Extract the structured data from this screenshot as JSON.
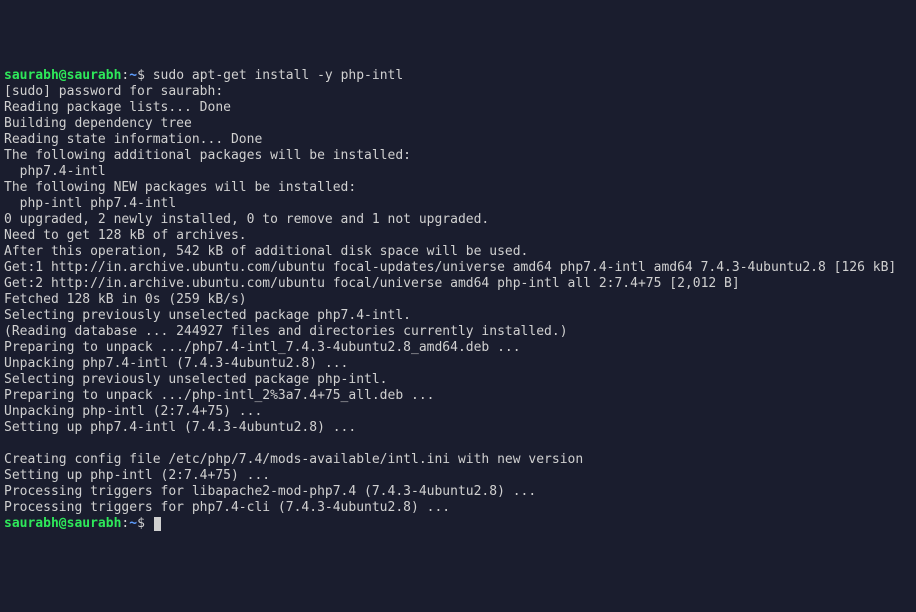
{
  "prompt1": {
    "user": "saurabh",
    "at": "@",
    "host": "saurabh",
    "colon": ":",
    "path": "~",
    "dollar": "$ ",
    "command": "sudo apt-get install -y php-intl"
  },
  "lines": [
    "[sudo] password for saurabh: ",
    "Reading package lists... Done",
    "Building dependency tree       ",
    "Reading state information... Done",
    "The following additional packages will be installed:",
    "  php7.4-intl",
    "The following NEW packages will be installed:",
    "  php-intl php7.4-intl",
    "0 upgraded, 2 newly installed, 0 to remove and 1 not upgraded.",
    "Need to get 128 kB of archives.",
    "After this operation, 542 kB of additional disk space will be used.",
    "Get:1 http://in.archive.ubuntu.com/ubuntu focal-updates/universe amd64 php7.4-intl amd64 7.4.3-4ubuntu2.8 [126 kB]",
    "Get:2 http://in.archive.ubuntu.com/ubuntu focal/universe amd64 php-intl all 2:7.4+75 [2,012 B]",
    "Fetched 128 kB in 0s (259 kB/s)    ",
    "Selecting previously unselected package php7.4-intl.",
    "(Reading database ... 244927 files and directories currently installed.)",
    "Preparing to unpack .../php7.4-intl_7.4.3-4ubuntu2.8_amd64.deb ...",
    "Unpacking php7.4-intl (7.4.3-4ubuntu2.8) ...",
    "Selecting previously unselected package php-intl.",
    "Preparing to unpack .../php-intl_2%3a7.4+75_all.deb ...",
    "Unpacking php-intl (2:7.4+75) ...",
    "Setting up php7.4-intl (7.4.3-4ubuntu2.8) ...",
    "",
    "Creating config file /etc/php/7.4/mods-available/intl.ini with new version",
    "Setting up php-intl (2:7.4+75) ...",
    "Processing triggers for libapache2-mod-php7.4 (7.4.3-4ubuntu2.8) ...",
    "Processing triggers for php7.4-cli (7.4.3-4ubuntu2.8) ..."
  ],
  "prompt2": {
    "user": "saurabh",
    "at": "@",
    "host": "saurabh",
    "colon": ":",
    "path": "~",
    "dollar": "$ "
  }
}
